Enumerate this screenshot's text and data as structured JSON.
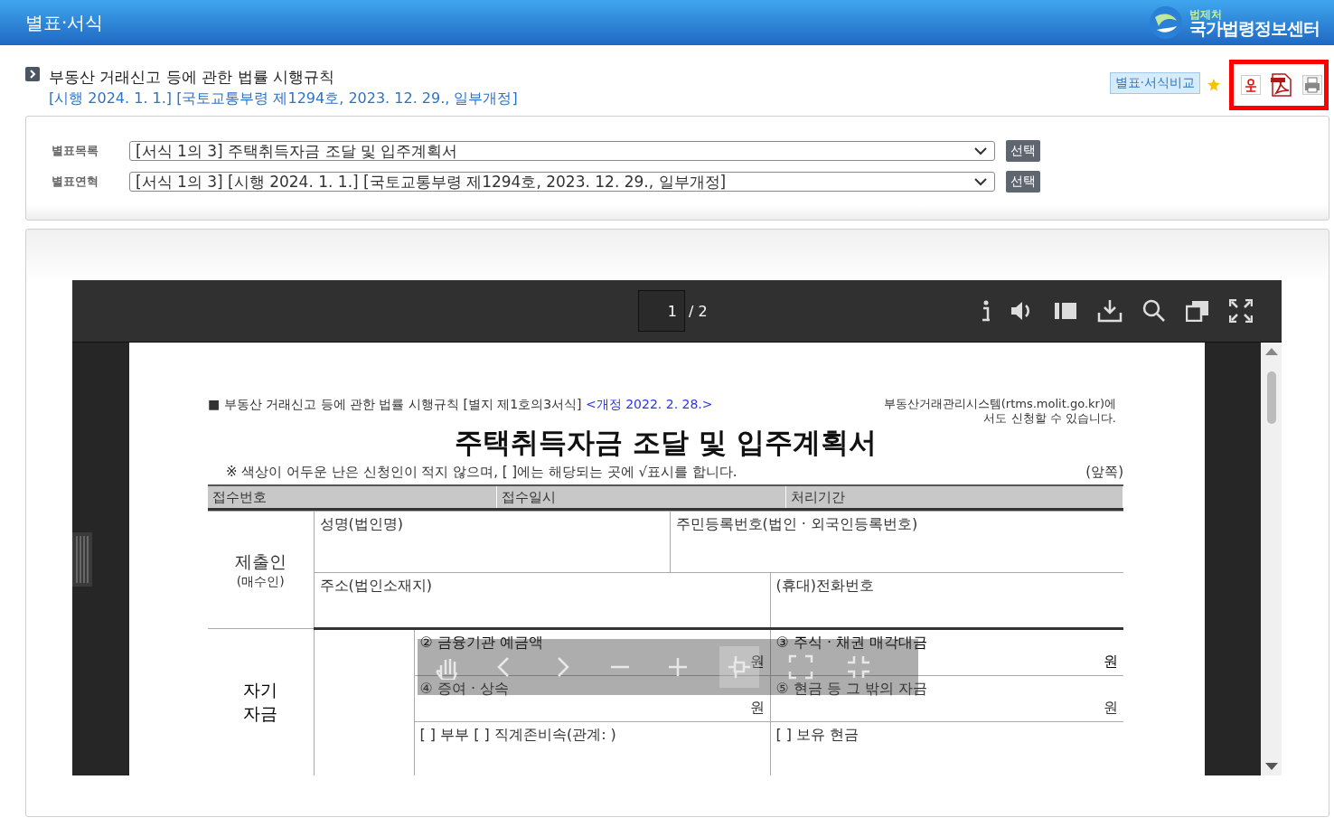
{
  "header": {
    "title": "별표·서식",
    "logo_small": "법제처",
    "logo_main": "국가법령정보센터"
  },
  "law": {
    "name": "부동산 거래신고 등에 관한 법률 시행규칙",
    "history": "[시행 2024. 1. 1.] [국토교통부령 제1294호, 2023. 12. 29., 일부개정]",
    "compare_button": "별표·서식비교"
  },
  "selectors": [
    {
      "label": "별표목록",
      "value": "[서식 1의 3] 주택취득자금 조달 및 입주계획서",
      "button": "선택"
    },
    {
      "label": "별표연혁",
      "value": "[서식 1의 3] [시행 2024. 1. 1.] [국토교통부령 제1294호, 2023. 12. 29., 일부개정]",
      "button": "선택"
    }
  ],
  "viewer": {
    "page_current": "1",
    "page_total": "/ 2"
  },
  "document": {
    "header_left": "■ 부동산 거래신고 등에 관한 법률 시행규칙 [별지 제1호의3서식]",
    "revision": "<개정 2022. 2. 28.>",
    "note_lines": [
      "부동산거래관리시스템(rtms.molit.go.kr)에",
      "서도 신청할 수 있습니다."
    ],
    "title": "주택취득자금 조달 및 입주계획서",
    "instruction": "※ 색상이 어두운 난은 신청인이 적지 않으며, [ ]에는 해당되는 곳에 √표시를 합니다.",
    "side": "(앞쪽)",
    "receipt_headers": [
      "접수번호",
      "접수일시",
      "처리기간"
    ],
    "submitter": {
      "label": "제출인",
      "sub": "(매수인)",
      "name": "성명(법인명)",
      "id": "주민등록번호(법인 · 외국인등록번호)",
      "address": "주소(법인소재지)",
      "phone": "(휴대)전화번호"
    },
    "own_funds": {
      "label": "자기 자금",
      "items": [
        {
          "text": "② 금융기관 예금액",
          "unit": "원"
        },
        {
          "text": "③ 주식 · 채권 매각대금",
          "unit": "원"
        },
        {
          "text": "④ 증여 · 상속",
          "unit": "원"
        },
        {
          "text": "⑤ 현금 등 그 밖의 자금",
          "unit": "원"
        }
      ],
      "relation": "[ ] 부부 [ ] 직계존비속(관계:        )",
      "cash": "[ ] 보유 현금"
    }
  }
}
